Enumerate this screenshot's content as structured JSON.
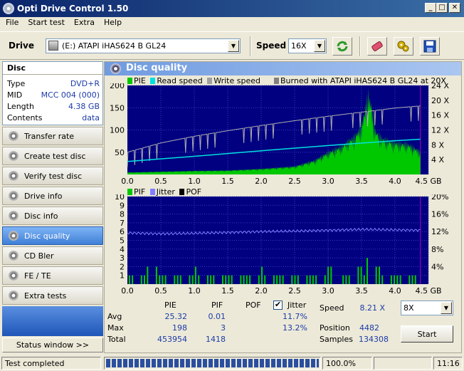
{
  "window": {
    "title": "Opti Drive Control 1.50"
  },
  "menu": [
    "File",
    "Start test",
    "Extra",
    "Help"
  ],
  "toolbar": {
    "drive_label": "Drive",
    "drive_value": "(E:)   ATAPI iHAS624   B GL24",
    "speed_label": "Speed",
    "speed_value": "16X"
  },
  "disc": {
    "header": "Disc",
    "rows": [
      {
        "label": "Type",
        "value": "DVD+R"
      },
      {
        "label": "MID",
        "value": "MCC 004 (000)"
      },
      {
        "label": "Length",
        "value": "4.38 GB"
      },
      {
        "label": "Contents",
        "value": "data"
      }
    ]
  },
  "nav": [
    {
      "label": "Transfer rate",
      "icon": "disc-icon"
    },
    {
      "label": "Create test disc",
      "icon": "disc-icon"
    },
    {
      "label": "Verify test disc",
      "icon": "disc-icon"
    },
    {
      "label": "Drive info",
      "icon": "disc-icon"
    },
    {
      "label": "Disc info",
      "icon": "disc-icon"
    },
    {
      "label": "Disc quality",
      "icon": "disc-icon",
      "active": true
    },
    {
      "label": "CD Bler",
      "icon": "disc-icon"
    },
    {
      "label": "FE / TE",
      "icon": "disc-icon"
    },
    {
      "label": "Extra tests",
      "icon": "disc-icon"
    }
  ],
  "status_window_label": "Status window >>",
  "panel_title": "Disc quality",
  "chart_data": [
    {
      "type": "line",
      "legend": [
        "PIE",
        "Read speed",
        "Write speed",
        "Burned with ATAPI iHAS624   B GL24 at 20X"
      ],
      "colors": {
        "PIE": "#00c800",
        "Read speed": "#00e0e0",
        "Write speed": "#a0a0a0",
        "Burned": "#808080"
      },
      "x_ticks": [
        "0.0",
        "0.5",
        "1.0",
        "1.5",
        "2.0",
        "2.5",
        "3.0",
        "3.5",
        "4.0",
        "4.5 GB"
      ],
      "xlim": [
        0,
        4.5
      ],
      "y_ticks_left": [
        "200",
        "150",
        "100",
        "50"
      ],
      "ylim_left": [
        0,
        200
      ],
      "y_ticks_right": [
        "24 X",
        "20 X",
        "16 X",
        "12 X",
        "8 X",
        "4 X"
      ],
      "ylim_right": [
        0,
        24
      ],
      "series": [
        {
          "name": "PIE",
          "x": [
            0,
            0.5,
            1.0,
            1.5,
            2.0,
            2.5,
            2.8,
            3.0,
            3.2,
            3.4,
            3.5,
            3.6,
            3.65,
            3.7,
            3.8,
            4.0,
            4.2,
            4.4,
            4.38
          ],
          "values": [
            5,
            7,
            9,
            10,
            14,
            20,
            35,
            55,
            70,
            95,
            120,
            198,
            170,
            110,
            90,
            80,
            75,
            55,
            30
          ]
        },
        {
          "name": "Read speed",
          "x": [
            0,
            1,
            2,
            3,
            4,
            4.38
          ],
          "values": [
            3.5,
            4.9,
            6.4,
            7.8,
            9.1,
            9.5
          ]
        },
        {
          "name": "Write speed",
          "x": [
            0,
            0.5,
            1,
            1.5,
            2,
            2.5,
            3,
            3.5,
            4,
            4.38
          ],
          "values": [
            6,
            8.5,
            10.3,
            11.8,
            13.2,
            14.5,
            15.7,
            16.8,
            17.9,
            18.5
          ]
        }
      ]
    },
    {
      "type": "line",
      "legend": [
        "PIF",
        "Jitter",
        "POF"
      ],
      "colors": {
        "PIF": "#00c800",
        "Jitter": "#8080ff",
        "POF": "#000000"
      },
      "x_ticks": [
        "0.0",
        "0.5",
        "1.0",
        "1.5",
        "2.0",
        "2.5",
        "3.0",
        "3.5",
        "4.0",
        "4.5 GB"
      ],
      "xlim": [
        0,
        4.5
      ],
      "y_ticks_left": [
        "10",
        "9",
        "8",
        "7",
        "6",
        "5",
        "4",
        "3",
        "2",
        "1"
      ],
      "ylim_left": [
        0,
        10
      ],
      "y_ticks_right": [
        "20%",
        "16%",
        "12%",
        "8%",
        "4%"
      ],
      "ylim_right": [
        0,
        20
      ],
      "series": [
        {
          "name": "PIF",
          "x": [
            0.1,
            0.3,
            0.6,
            0.9,
            1.2,
            1.6,
            1.9,
            2.2,
            2.6,
            2.9,
            3.1,
            3.3,
            3.6,
            3.8,
            4.1,
            4.3
          ],
          "values": [
            1,
            2,
            1,
            2,
            1,
            1,
            2,
            1,
            1,
            2,
            2,
            1,
            3,
            2,
            1,
            1
          ]
        },
        {
          "name": "Jitter",
          "x": [
            0,
            0.5,
            1,
            1.5,
            2,
            2.5,
            3,
            3.5,
            4,
            4.38
          ],
          "values": [
            11.7,
            11.5,
            11.6,
            11.8,
            12.0,
            12.1,
            12.3,
            12.5,
            12.4,
            12.3
          ]
        }
      ]
    }
  ],
  "stats": {
    "col_pie": "PIE",
    "col_pif": "PIF",
    "col_pof": "POF",
    "col_jitter": "Jitter",
    "jitter_checked": true,
    "row_avg": "Avg",
    "row_max": "Max",
    "row_total": "Total",
    "avg": {
      "pie": "25.32",
      "pif": "0.01",
      "jitter": "11.7%"
    },
    "max": {
      "pie": "198",
      "pif": "3",
      "jitter": "13.2%"
    },
    "total": {
      "pie": "453954",
      "pif": "1418"
    },
    "speed_label": "Speed",
    "speed_value": "8.21 X",
    "position_label": "Position",
    "position_value": "4482",
    "samples_label": "Samples",
    "samples_value": "134308",
    "test_speed": "8X",
    "start_label": "Start"
  },
  "statusbar": {
    "status": "Test completed",
    "progress": 1.0,
    "progress_text": "100.0%",
    "time": "11:16"
  }
}
